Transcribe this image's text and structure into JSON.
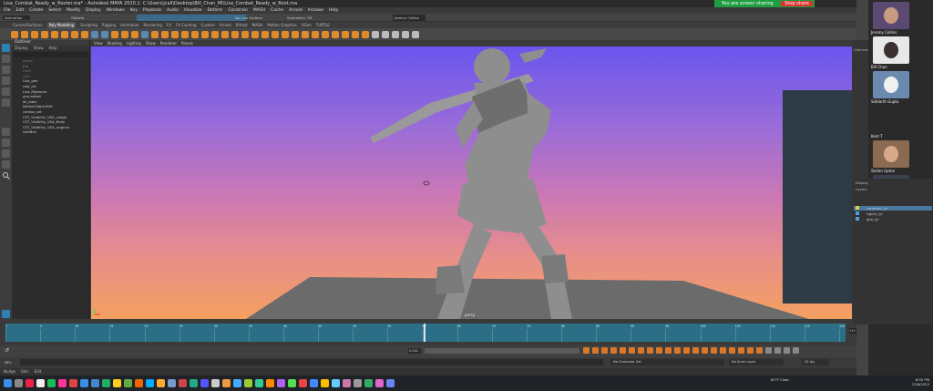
{
  "window": {
    "title": "Lisa_Combat_Ready_w_Rooter.ma* - Autodesk MAYA 2020.1: C:\\Users\\jcali\\Desktop\\Bill_Chan_Ml\\Lisa_Combat_Ready_w_Root.ma"
  },
  "share_bar": {
    "text": "You are screen sharing",
    "stop_label": "Stop share"
  },
  "menus": [
    "File",
    "Edit",
    "Create",
    "Select",
    "Modify",
    "Display",
    "Windows",
    "Key",
    "Playback",
    "Audio",
    "Visualize",
    "Deform",
    "Constrain",
    "MASH",
    "Cache",
    "Arnold",
    "Arclaws",
    "Help"
  ],
  "statusline": {
    "mode": "Animation",
    "objects": "Objects",
    "no_live": "No Live Surface",
    "sym": "Symmetry: Off",
    "user": "Jeremy Collins"
  },
  "shelf": {
    "tabs": [
      "Curves/Surfaces",
      "Poly Modeling",
      "Sculpting",
      "Rigging",
      "Animation",
      "Rendering",
      "FX",
      "FX Caching",
      "Custom",
      "Arnold",
      "Bifrost",
      "MASH",
      "Motion Graphics",
      "XGen",
      "TURTLE"
    ],
    "active_tab": "Poly Modeling"
  },
  "outliner": {
    "title": "Outliner",
    "menu": [
      "Display",
      "Show",
      "Help"
    ],
    "items": [
      {
        "label": "persp",
        "dim": true
      },
      {
        "label": "top",
        "dim": true
      },
      {
        "label": "front",
        "dim": true
      },
      {
        "label": "side",
        "dim": true
      },
      {
        "label": "Lisa_geo",
        "dim": false
      },
      {
        "label": "root_jnt",
        "dim": false
      },
      {
        "label": "Lisa_Rigmove",
        "dim": false
      },
      {
        "label": "groundball",
        "dim": false
      },
      {
        "label": "all_label",
        "dim": false
      },
      {
        "label": "DefaultObjectSet",
        "dim": false
      },
      {
        "label": "combo_set",
        "dim": false
      },
      {
        "label": "CST_Visibility_VSA_Lodge",
        "dim": false
      },
      {
        "label": "CST_Visibility_VSA_Body",
        "dim": false
      },
      {
        "label": "CST_Visibility_VSA_original",
        "dim": false
      },
      {
        "label": "sideBall",
        "dim": false
      }
    ]
  },
  "viewport": {
    "menu": [
      "View",
      "Shading",
      "Lighting",
      "Show",
      "Renderer",
      "Panels"
    ],
    "camera_label": "persp"
  },
  "timeline": {
    "ticks": [
      "1",
      "5",
      "10",
      "15",
      "20",
      "25",
      "30",
      "35",
      "40",
      "45",
      "50",
      "55",
      "60",
      "65",
      "70",
      "75",
      "80",
      "85",
      "90",
      "95",
      "100",
      "105",
      "110",
      "115",
      "120"
    ],
    "current_frame": "120"
  },
  "range": {
    "start": "0.001",
    "end": "120",
    "fps": "24 fps"
  },
  "cmdline": {
    "mode": "MEL",
    "no_character": "No Character Set",
    "no_anim_layer": "No Anim Layer"
  },
  "helpline": {
    "items": [
      "Nudge",
      "Skin",
      "Edit"
    ]
  },
  "right_panel": {
    "label": "Channels",
    "layer_tab": "Display",
    "layers_label": "Layers"
  },
  "layers": [
    {
      "name": "cameras_lyr",
      "color": "#e0d040",
      "selected": true
    },
    {
      "name": "rigctrl_lyr",
      "color": "#4aa0e0",
      "selected": false
    },
    {
      "name": "geo_lyr",
      "color": "#4aa0e0",
      "selected": false
    }
  ],
  "participants": [
    {
      "name": "Jeremy Collins",
      "bg": "#5a4a72",
      "face": "#c89a80"
    },
    {
      "name": "Bill Chan",
      "bg": "#e8e8e8",
      "face": "#3a3030"
    },
    {
      "name": "Siddarth Gupta",
      "bg": "#6a8ab0",
      "face": "#f0f0f0"
    },
    {
      "name": "Kent T",
      "bg": "#2a2a2a",
      "face": "#2a2a2a"
    },
    {
      "name": "Stefan Upton",
      "bg": "#8a6a50",
      "face": "#d8a888"
    },
    {
      "name": "Samuel Tao",
      "bg": "#3a4250",
      "face": "#c08868"
    }
  ],
  "tray": {
    "weather": "80°F Clear",
    "time": "8:05 PM",
    "date": "7/28/2022"
  },
  "colors": {
    "accent": "#2b6e86",
    "sky_top": "#6a55ee",
    "sky_bottom": "#f4a060",
    "share": "#1e9e3e"
  }
}
